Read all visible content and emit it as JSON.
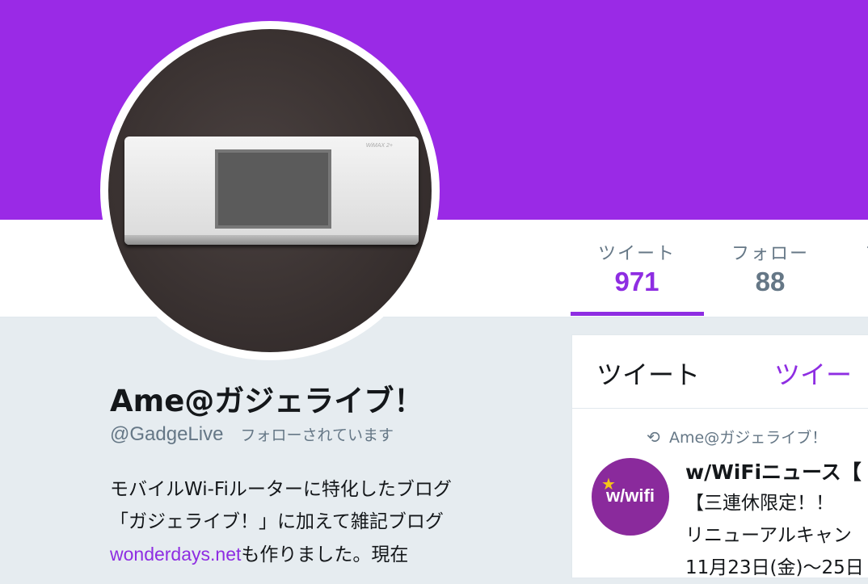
{
  "colors": {
    "banner": "#9a2ae6",
    "accent": "#8e2de2",
    "muted": "#657786"
  },
  "stats": [
    {
      "label": "ツイート",
      "value": "971",
      "active": true
    },
    {
      "label": "フォロー",
      "value": "88",
      "active": false
    },
    {
      "label": "フ",
      "value": ""
    }
  ],
  "profile": {
    "name": "Ame@ガジェライブ！",
    "handle": "@GadgeLive",
    "follows_you": "フォローされています",
    "bio_line1": "モバイルWi-Fiルーターに特化したブログ",
    "bio_line2": "「ガジェライブ！」に加えて雑記ブログ",
    "bio_link": "wonderdays.net",
    "bio_line3_rest": "も作りました。現在",
    "avatar_device_brand": "WiMAX 2+"
  },
  "timeline": {
    "tabs": [
      "ツイート",
      "ツイー"
    ],
    "retweet_icon": "retweet-icon",
    "retweet_by": "Ame@ガジェライブ！",
    "tweet": {
      "avatar_logo": "w/wifi",
      "author": "w/WiFiニュース【",
      "line1": "【三連休限定！！",
      "line2": "リニューアルキャン",
      "line3": "11月23日(金)～25日"
    }
  }
}
